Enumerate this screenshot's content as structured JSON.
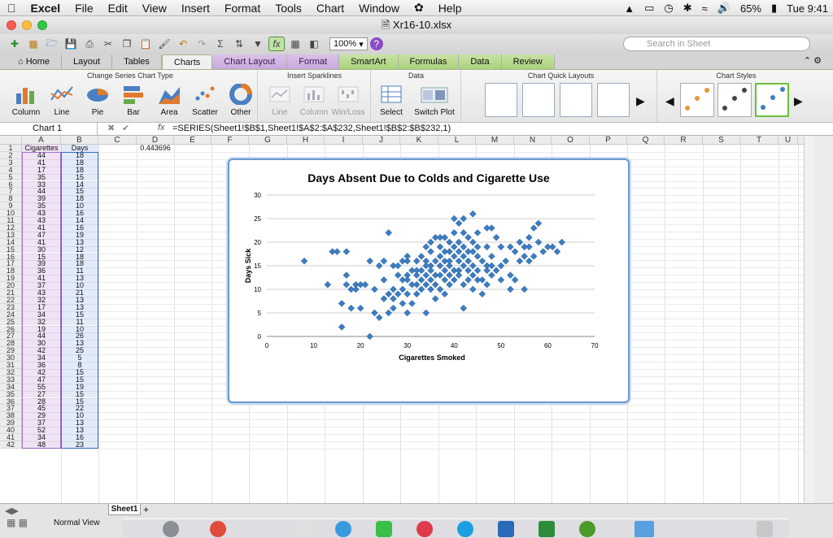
{
  "menubar": {
    "app_name": "Excel",
    "items": [
      "File",
      "Edit",
      "View",
      "Insert",
      "Format",
      "Tools",
      "Chart",
      "Window",
      "Help"
    ],
    "battery": "65%",
    "clock": "Tue 9:41"
  },
  "window": {
    "title": "Xr16-10.xlsx"
  },
  "toolbar": {
    "zoom": "100%",
    "search_placeholder": "Search in Sheet"
  },
  "ribbon": {
    "tabs": [
      "Home",
      "Layout",
      "Tables",
      "Charts",
      "Chart Layout",
      "Format",
      "SmartArt",
      "Formulas",
      "Data",
      "Review"
    ],
    "groups": {
      "change_type": {
        "title": "Change Series Chart Type",
        "buttons": [
          "Column",
          "Line",
          "Pie",
          "Bar",
          "Area",
          "Scatter",
          "Other"
        ]
      },
      "sparklines": {
        "title": "Insert Sparklines",
        "buttons": [
          "Line",
          "Column",
          "Win/Loss"
        ]
      },
      "data": {
        "title": "Data",
        "buttons": [
          "Select",
          "Switch Plot"
        ]
      },
      "quick_layouts": {
        "title": "Chart Quick Layouts"
      },
      "styles": {
        "title": "Chart Styles"
      }
    }
  },
  "formula_bar": {
    "name_box": "Chart 1",
    "fx": "fx",
    "formula": "=SERIES(Sheet1!$B$1,Sheet1!$A$2:$A$232,Sheet1!$B$2:$B$232,1)"
  },
  "columns": [
    "A",
    "B",
    "C",
    "D",
    "E",
    "F",
    "G",
    "H",
    "I",
    "J",
    "K",
    "L",
    "M",
    "N",
    "O",
    "P",
    "Q",
    "R",
    "S",
    "T",
    "U"
  ],
  "sheet": {
    "header_row": [
      "Cigarettes",
      "Days"
    ],
    "rows": [
      [
        44,
        18
      ],
      [
        41,
        18
      ],
      [
        17,
        18
      ],
      [
        35,
        15
      ],
      [
        33,
        14
      ],
      [
        44,
        15
      ],
      [
        39,
        18
      ],
      [
        35,
        10
      ],
      [
        43,
        16
      ],
      [
        43,
        14
      ],
      [
        41,
        16
      ],
      [
        47,
        19
      ],
      [
        41,
        13
      ],
      [
        30,
        12
      ],
      [
        15,
        18
      ],
      [
        39,
        18
      ],
      [
        36,
        11
      ],
      [
        41,
        13
      ],
      [
        37,
        10
      ],
      [
        43,
        21
      ],
      [
        32,
        13
      ],
      [
        17,
        13
      ],
      [
        34,
        15
      ],
      [
        32,
        11
      ],
      [
        19,
        10
      ],
      [
        44,
        26
      ],
      [
        30,
        13
      ],
      [
        42,
        25
      ],
      [
        34,
        5
      ],
      [
        36,
        8
      ],
      [
        42,
        15
      ],
      [
        47,
        15
      ],
      [
        55,
        19
      ],
      [
        27,
        15
      ],
      [
        28,
        15
      ],
      [
        45,
        22
      ],
      [
        29,
        10
      ],
      [
        37,
        13
      ],
      [
        52,
        13
      ],
      [
        34,
        16
      ],
      [
        48,
        23
      ]
    ],
    "d1_value": "0.443696"
  },
  "chart_data": {
    "type": "scatter",
    "title": "Days Absent Due to Colds and Cigarette Use",
    "xlabel": "Cigarettes Smoked",
    "ylabel": "Days Sick",
    "xlim": [
      0,
      70
    ],
    "ylim": [
      0,
      30
    ],
    "xticks": [
      0,
      10,
      20,
      30,
      40,
      50,
      60,
      70
    ],
    "yticks": [
      0,
      5,
      10,
      15,
      20,
      25,
      30
    ],
    "grid": "horizontal",
    "legend": "none",
    "marker_color": "#3d7cc0",
    "series": [
      {
        "points": [
          [
            8,
            16
          ],
          [
            13,
            11
          ],
          [
            14,
            18
          ],
          [
            15,
            18
          ],
          [
            16,
            7
          ],
          [
            16,
            2
          ],
          [
            17,
            18
          ],
          [
            17,
            13
          ],
          [
            17,
            11
          ],
          [
            18,
            6
          ],
          [
            18,
            10
          ],
          [
            19,
            11
          ],
          [
            19,
            10
          ],
          [
            20,
            6
          ],
          [
            20,
            11
          ],
          [
            21,
            11
          ],
          [
            22,
            0
          ],
          [
            22,
            16
          ],
          [
            23,
            5
          ],
          [
            23,
            10
          ],
          [
            24,
            4
          ],
          [
            24,
            15
          ],
          [
            25,
            16
          ],
          [
            25,
            12
          ],
          [
            25,
            8
          ],
          [
            26,
            22
          ],
          [
            26,
            9
          ],
          [
            26,
            5
          ],
          [
            27,
            15
          ],
          [
            27,
            10
          ],
          [
            27,
            6
          ],
          [
            27,
            8
          ],
          [
            28,
            15
          ],
          [
            28,
            13
          ],
          [
            28,
            9
          ],
          [
            29,
            10
          ],
          [
            29,
            7
          ],
          [
            29,
            16
          ],
          [
            29,
            12
          ],
          [
            30,
            13
          ],
          [
            30,
            12
          ],
          [
            30,
            16
          ],
          [
            30,
            17
          ],
          [
            30,
            9
          ],
          [
            30,
            5
          ],
          [
            31,
            14
          ],
          [
            31,
            11
          ],
          [
            31,
            7
          ],
          [
            32,
            13
          ],
          [
            32,
            11
          ],
          [
            32,
            14
          ],
          [
            32,
            16
          ],
          [
            32,
            9
          ],
          [
            33,
            14
          ],
          [
            33,
            12
          ],
          [
            33,
            10
          ],
          [
            33,
            17
          ],
          [
            34,
            15
          ],
          [
            34,
            16
          ],
          [
            34,
            13
          ],
          [
            34,
            5
          ],
          [
            34,
            11
          ],
          [
            34,
            19
          ],
          [
            35,
            15
          ],
          [
            35,
            10
          ],
          [
            35,
            12
          ],
          [
            35,
            14
          ],
          [
            35,
            18
          ],
          [
            35,
            20
          ],
          [
            36,
            11
          ],
          [
            36,
            8
          ],
          [
            36,
            13
          ],
          [
            36,
            16
          ],
          [
            36,
            21
          ],
          [
            37,
            10
          ],
          [
            37,
            13
          ],
          [
            37,
            17
          ],
          [
            37,
            19
          ],
          [
            37,
            15
          ],
          [
            37,
            21
          ],
          [
            38,
            14
          ],
          [
            38,
            12
          ],
          [
            38,
            16
          ],
          [
            38,
            9
          ],
          [
            38,
            18
          ],
          [
            38,
            21
          ],
          [
            39,
            18
          ],
          [
            39,
            15
          ],
          [
            39,
            13
          ],
          [
            39,
            11
          ],
          [
            39,
            16
          ],
          [
            39,
            20
          ],
          [
            40,
            17
          ],
          [
            40,
            14
          ],
          [
            40,
            12
          ],
          [
            40,
            25
          ],
          [
            40,
            22
          ],
          [
            40,
            19
          ],
          [
            41,
            16
          ],
          [
            41,
            13
          ],
          [
            41,
            18
          ],
          [
            41,
            14
          ],
          [
            41,
            20
          ],
          [
            41,
            24
          ],
          [
            42,
            15
          ],
          [
            42,
            25
          ],
          [
            42,
            6
          ],
          [
            42,
            17
          ],
          [
            42,
            11
          ],
          [
            42,
            19
          ],
          [
            42,
            22
          ],
          [
            43,
            14
          ],
          [
            43,
            16
          ],
          [
            43,
            21
          ],
          [
            43,
            12
          ],
          [
            43,
            18
          ],
          [
            44,
            18
          ],
          [
            44,
            15
          ],
          [
            44,
            26
          ],
          [
            44,
            13
          ],
          [
            44,
            20
          ],
          [
            44,
            10
          ],
          [
            45,
            22
          ],
          [
            45,
            17
          ],
          [
            45,
            14
          ],
          [
            45,
            12
          ],
          [
            45,
            19
          ],
          [
            46,
            16
          ],
          [
            46,
            12
          ],
          [
            46,
            9
          ],
          [
            47,
            15
          ],
          [
            47,
            19
          ],
          [
            47,
            14
          ],
          [
            47,
            11
          ],
          [
            47,
            23
          ],
          [
            48,
            23
          ],
          [
            48,
            17
          ],
          [
            48,
            13
          ],
          [
            48,
            15
          ],
          [
            49,
            14
          ],
          [
            49,
            21
          ],
          [
            50,
            12
          ],
          [
            50,
            15
          ],
          [
            50,
            19
          ],
          [
            51,
            16
          ],
          [
            52,
            13
          ],
          [
            52,
            19
          ],
          [
            52,
            10
          ],
          [
            53,
            18
          ],
          [
            53,
            12
          ],
          [
            54,
            20
          ],
          [
            54,
            16
          ],
          [
            55,
            19
          ],
          [
            55,
            17
          ],
          [
            55,
            10
          ],
          [
            56,
            16
          ],
          [
            56,
            19
          ],
          [
            56,
            21
          ],
          [
            57,
            23
          ],
          [
            57,
            17
          ],
          [
            58,
            24
          ],
          [
            58,
            20
          ],
          [
            59,
            18
          ],
          [
            60,
            19
          ],
          [
            61,
            19
          ],
          [
            62,
            18
          ],
          [
            63,
            20
          ]
        ]
      }
    ]
  },
  "bottom": {
    "sheet_tab": "Sheet1",
    "status": "Normal View"
  },
  "colors": {
    "accent_green": "#a9d27a",
    "chart_layout_tab": "#c8a9dd",
    "marker": "#3d7cc0"
  }
}
